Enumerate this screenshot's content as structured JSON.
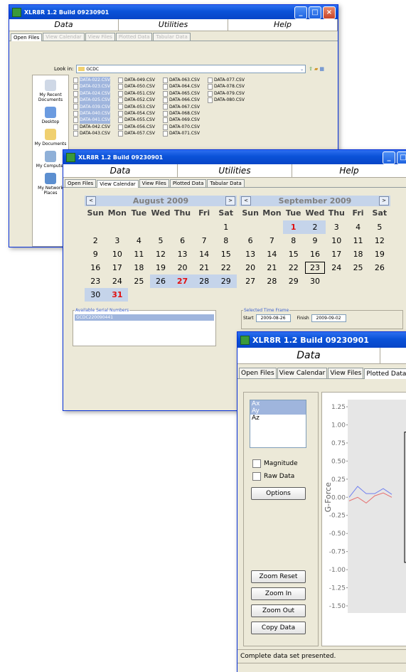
{
  "win1": {
    "title": "XLR8R 1.2 Build 09230901",
    "menus": [
      "Data",
      "Utilities",
      "Help"
    ],
    "tabs": [
      "Open Files",
      "View Calendar",
      "View Files",
      "Plotted Data",
      "Tabular Data"
    ],
    "look_in_label": "Look in:",
    "look_in_value": "GCDC",
    "places": [
      "My Recent Documents",
      "Desktop",
      "My Documents",
      "My Computer",
      "My Network Places"
    ],
    "files_col1": [
      "DATA-022.CSV",
      "DATA-023.CSV",
      "DATA-024.CSV",
      "DATA-025.CSV",
      "DATA-039.CSV",
      "DATA-040.CSV",
      "DATA-041.CSV",
      "DATA-042.CSV",
      "DATA-043.CSV"
    ],
    "files_col2": [
      "DATA-049.CSV",
      "DATA-050.CSV",
      "DATA-051.CSV",
      "DATA-052.CSV",
      "DATA-053.CSV",
      "DATA-054.CSV",
      "DATA-055.CSV",
      "DATA-056.CSV",
      "DATA-057.CSV"
    ],
    "files_col3": [
      "DATA-063.CSV",
      "DATA-064.CSV",
      "DATA-065.CSV",
      "DATA-066.CSV",
      "DATA-067.CSV",
      "DATA-068.CSV",
      "DATA-069.CSV",
      "DATA-070.CSV",
      "DATA-071.CSV"
    ],
    "files_col4": [
      "DATA-077.CSV",
      "DATA-078.CSV",
      "DATA-079.CSV",
      "DATA-080.CSV"
    ]
  },
  "win2": {
    "title": "XLR8R 1.2 Build 09230901",
    "menus": [
      "Data",
      "Utilities",
      "Help"
    ],
    "tabs": [
      "Open Files",
      "View Calendar",
      "View Files",
      "Plotted Data",
      "Tabular Data"
    ],
    "dow": [
      "Sun",
      "Mon",
      "Tue",
      "Wed",
      "Thu",
      "Fri",
      "Sat"
    ],
    "aug_title": "August 2009",
    "sep_title": "September 2009",
    "aug_days": [
      "",
      "",
      "",
      "",
      "",
      "",
      "1",
      "2",
      "3",
      "4",
      "5",
      "6",
      "7",
      "8",
      "9",
      "10",
      "11",
      "12",
      "13",
      "14",
      "15",
      "16",
      "17",
      "18",
      "19",
      "20",
      "21",
      "22",
      "23",
      "24",
      "25",
      "26",
      "27",
      "28",
      "29",
      "30",
      "31"
    ],
    "sep_days": [
      "",
      "",
      "1",
      "2",
      "3",
      "4",
      "5",
      "6",
      "7",
      "8",
      "9",
      "10",
      "11",
      "12",
      "13",
      "14",
      "15",
      "16",
      "17",
      "18",
      "19",
      "20",
      "21",
      "22",
      "23",
      "24",
      "25",
      "26",
      "27",
      "28",
      "29",
      "30"
    ],
    "serial_legend": "Available Serial Numbers",
    "serial_value": "GCDC220090441",
    "tf_legend": "Selected Time Frame",
    "start_label": "Start",
    "start_value": "2009-08-26",
    "finish_label": "Finish",
    "finish_value": "2009-09-02"
  },
  "win3": {
    "title": "XLR8R 1.2 Build 09230901",
    "menu": "Data",
    "tabs": [
      "Open Files",
      "View Calendar",
      "View Files",
      "Plotted Data"
    ],
    "axes": [
      "Ax",
      "Ay",
      "Az"
    ],
    "magnitude": "Magnitude",
    "raw_data": "Raw Data",
    "options": "Options",
    "zoom_reset": "Zoom Reset",
    "zoom_in": "Zoom In",
    "zoom_out": "Zoom Out",
    "copy_data": "Copy Data",
    "status": "Complete data set presented."
  },
  "chart_data": {
    "type": "line",
    "ylabel": "G-Force",
    "ylim": [
      -1.5,
      1.25
    ],
    "yticks": [
      "1.25",
      "1.00",
      "0.75",
      "0.50",
      "0.25",
      "0.00",
      "-0.25",
      "-0.50",
      "-0.75",
      "-1.00",
      "-1.25",
      "-1.50"
    ],
    "series": [
      {
        "color": "#6f7ff0",
        "values": [
          0.0,
          0.15,
          0.05,
          0.05,
          0.12,
          0.04
        ]
      },
      {
        "color": "#e57070",
        "values": [
          -0.05,
          0.0,
          -0.08,
          0.02,
          0.06,
          0.0
        ]
      }
    ]
  },
  "colors": {
    "titlebar": "#0a52d8",
    "selection": "#9fb5dd",
    "calendar_highlight": "#c5d4ea",
    "red_day": "#e01010"
  }
}
